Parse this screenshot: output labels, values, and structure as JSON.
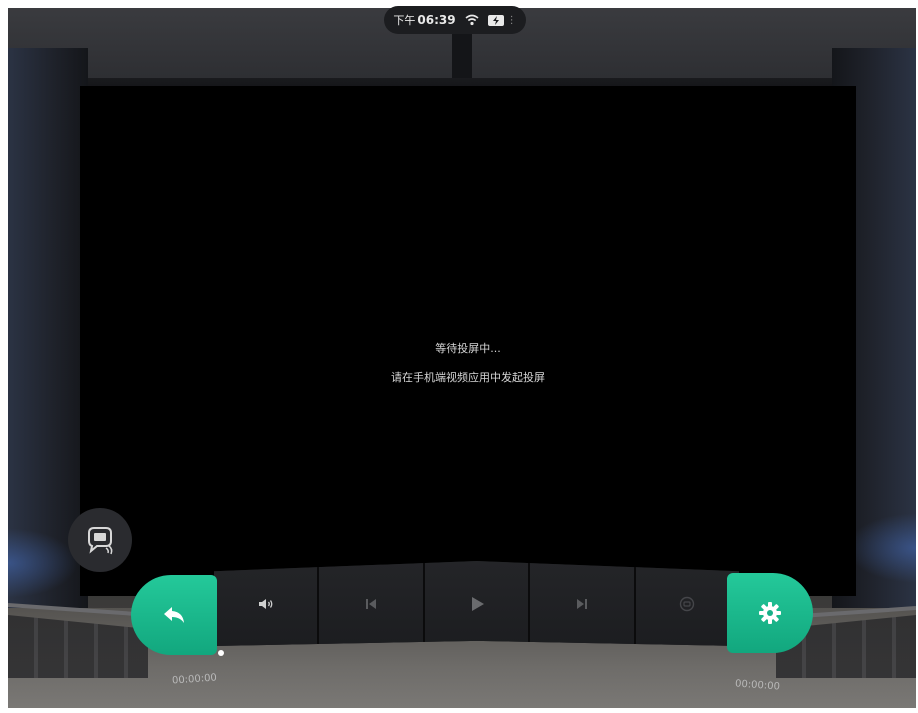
{
  "status_bar": {
    "time_prefix": "下午",
    "time": "06:39",
    "wifi_icon": "wifi-icon",
    "battery_icon": "battery-charging-icon",
    "more_icon": "more-dots-icon"
  },
  "screen": {
    "status_title": "等待投屏中...",
    "status_hint": "请在手机端视频应用中发起投屏"
  },
  "cast_button": {
    "icon": "cast-screen-icon"
  },
  "controls": {
    "back_icon": "back-arrow-icon",
    "volume_icon": "volume-icon",
    "previous_icon": "skip-previous-icon",
    "play_icon": "play-icon",
    "next_icon": "skip-next-icon",
    "mode_icon": "mode-icon",
    "settings_icon": "gear-icon"
  },
  "playback": {
    "current_time": "00:00:00",
    "total_time": "00:00:00",
    "progress": 0
  },
  "colors": {
    "accent_green": "#1ab98c",
    "screen": "#000000"
  }
}
